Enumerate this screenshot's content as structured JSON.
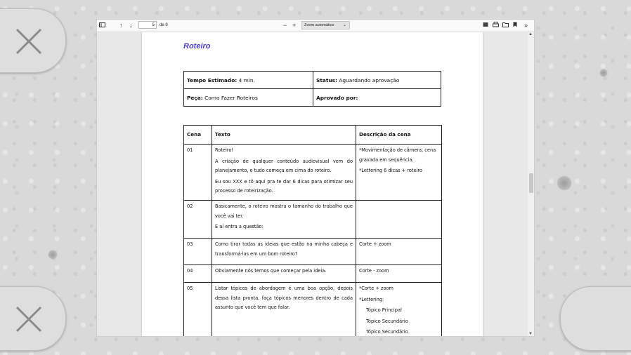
{
  "viewer": {
    "page_current": "5",
    "page_total": "de 9",
    "zoom": "Zoom automático"
  },
  "document": {
    "title": "Roteiro",
    "meta": {
      "tempo_label": "Tempo Estimado:",
      "tempo_value": "4 min.",
      "status_label": "Status:",
      "status_value": "Aguardando aprovação",
      "peca_label": "Peça:",
      "peca_value": "Como Fazer Roteiros",
      "aprovado_label": "Aprovado por:"
    },
    "headers": [
      "Cena",
      "Texto",
      "Descrição da cena"
    ],
    "rows": [
      {
        "cena": "01",
        "texto": [
          "Roteiro!",
          "A criação de qualquer conteúdo audiovisual vem do planejamento, e tudo começa em cima do roteiro.",
          "Eu sou XXX e tô aqui pra te dar 6 dicas para otimizar seu processo de roteirização."
        ],
        "desc": [
          "*Movimentação de câmera, cena gravada em sequência.",
          "*Lettering 6 dicas + roteiro"
        ]
      },
      {
        "cena": "02",
        "texto": [
          "Basicamente, o roteiro mostra o tamanho do trabalho que você vai ter.",
          "E aí entra a questão:"
        ],
        "desc": []
      },
      {
        "cena": "03",
        "texto": [
          "Como tirar todas as ideias que estão na minha cabeça e transformá-las em um bom roteiro?"
        ],
        "desc": [
          "Corte + zoom"
        ]
      },
      {
        "cena": "04",
        "texto": [
          "Obviamente nós temos que começar pela ideia."
        ],
        "desc": [
          "Corte - zoom"
        ]
      },
      {
        "cena": "05",
        "texto": [
          "Listar tópicos de abordagem é uma boa opção, depois dessa lista pronta, faça tópicos menores dentro de cada assunto que você tem que falar."
        ],
        "desc": [
          "*Corte + zoom",
          "*Lettering:"
        ],
        "desc_indented": [
          "Tópico Principal",
          "Tópico Secundário",
          "Tópico Secundário"
        ]
      }
    ]
  }
}
